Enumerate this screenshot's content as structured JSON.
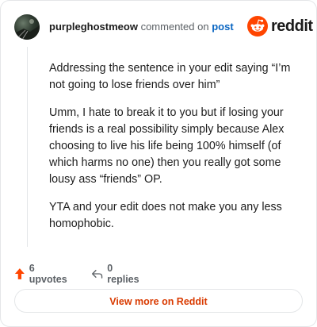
{
  "header": {
    "username": "purpleghostmeow",
    "commented_on": "commented on",
    "post_link": "post",
    "brand": "reddit"
  },
  "comment": {
    "paragraphs": [
      "Addressing the sentence in your edit saying “I’m not going to lose friends over him”",
      "Umm, I hate to break it to you but if losing your friends is a real possibility simply because Alex choosing to live his life being 100% himself (of which harms no one) then you really got some lousy ass “friends” OP.",
      "YTA and your edit does not make you any less homophobic."
    ]
  },
  "actions": {
    "upvotes": "6 upvotes",
    "replies": "0 replies"
  },
  "footer": {
    "view_more": "View more on Reddit"
  },
  "colors": {
    "accent": "#ff4500",
    "link": "#0a66c2",
    "view_more": "#d93a00"
  }
}
